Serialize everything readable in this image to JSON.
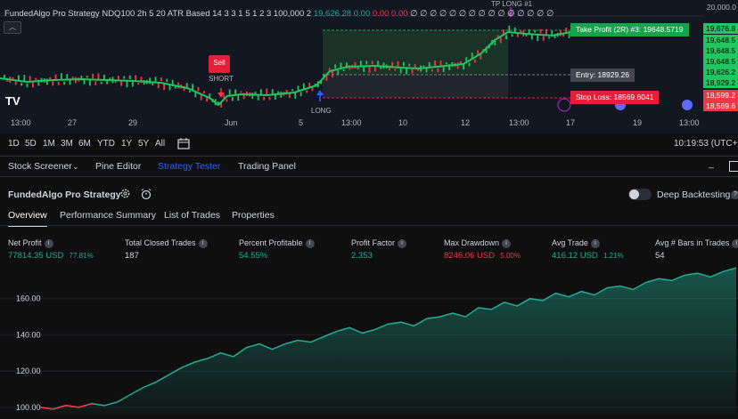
{
  "chart": {
    "legend": {
      "symbol_title": "FundedAlgo Pro Strategy",
      "params": "NDQ100 2h 5 20 ATR Based 14 3 3 1 5 1 2 3 100,000 2",
      "value_green": "19,626.28",
      "value_zero_green": "0.00",
      "value_zero_red": "0.00",
      "value_zero_red2": "0.00",
      "placeholder_symbols": "∅ ∅ ∅ ∅ ∅ ∅ ∅ ∅ ∅ ∅ ∅ ∅ ∅ ∅ ∅"
    },
    "collapse_icon": "chevron-up-icon",
    "top_price": "20,000.0",
    "price_labels": [
      {
        "text": "19,676.8",
        "color": "#22c55e"
      },
      {
        "text": "19,648.5",
        "color": "#22c55e"
      },
      {
        "text": "19,648.5",
        "color": "#22c55e"
      },
      {
        "text": "19,648.5",
        "color": "#22c55e"
      },
      {
        "text": "19,626.2",
        "color": "#22c55e"
      },
      {
        "text": "18,929.2",
        "color": "#22c55e"
      },
      {
        "text": "18,599.2",
        "color": "#f23645"
      },
      {
        "text": "18,569.6",
        "color": "#f23645"
      }
    ],
    "tp_label": "Take Profit (2R) #3: 19648.5719",
    "entry_label": "Entry: 18929.26",
    "sl_label": "Stop Loss: 18569.6041",
    "tp_long_label": "TP LONG #1",
    "sell_label": "Sell",
    "short_label": "SHORT",
    "long_label": "LONG",
    "logo_text": "TV",
    "x_labels": [
      "13:00",
      "27",
      "29",
      "Jun",
      "5",
      "13:00",
      "10",
      "12",
      "13:00",
      "17",
      "19",
      "13:00"
    ],
    "colors": {
      "up": "#22c55e",
      "down": "#f23645",
      "tp": "#16a34a",
      "entry": "#787b86",
      "sl": "#e51e3a"
    }
  },
  "range_bar": {
    "ranges": [
      "1D",
      "5D",
      "1M",
      "3M",
      "6M",
      "YTD",
      "1Y",
      "5Y",
      "All"
    ],
    "calendar_icon": "calendar-range-icon",
    "clock": "10:19:53 (UTC+"
  },
  "panel_tabs": {
    "items": [
      "Stock Screener",
      "Pine Editor",
      "Strategy Tester",
      "Trading Panel"
    ],
    "active": "Strategy Tester",
    "dropdown_icon": "chevron-down-icon",
    "minimize_icon": "minimize-icon",
    "maximize_icon": "maximize-icon"
  },
  "strategy": {
    "title": "FundedAlgo Pro Strategy",
    "settings_icon": "gear-icon",
    "alert_icon": "alarm-clock-icon",
    "deep_backtesting_label": "Deep Backtesting",
    "deep_backtesting_on": false,
    "subtabs": [
      "Overview",
      "Performance Summary",
      "List of Trades",
      "Properties"
    ],
    "active_subtab": "Overview"
  },
  "metrics": [
    {
      "label": "Net Profit",
      "value": "77814.35 USD",
      "extra": "77.81%",
      "color": "#22ab94"
    },
    {
      "label": "Total Closed Trades",
      "value": "187",
      "extra": "",
      "color": "#d1d4dc"
    },
    {
      "label": "Percent Profitable",
      "value": "54.55%",
      "extra": "",
      "color": "#22ab94"
    },
    {
      "label": "Profit Factor",
      "value": "2.353",
      "extra": "",
      "color": "#22ab94"
    },
    {
      "label": "Max Drawdown",
      "value": "8246.06 USD",
      "extra": "5.00%",
      "color": "#f23645"
    },
    {
      "label": "Avg Trade",
      "value": "416.12 USD",
      "extra": "1.21%",
      "color": "#22ab94"
    },
    {
      "label": "Avg # Bars in Trades",
      "value": "54",
      "extra": "",
      "color": "#d1d4dc"
    }
  ],
  "chart_data": {
    "type": "area",
    "title": "",
    "xlabel": "",
    "ylabel": "",
    "ylim": [
      96,
      180
    ],
    "y_ticks": [
      "100.00",
      "120.00",
      "140.00",
      "160.00"
    ],
    "y_tick_values": [
      100,
      120,
      140,
      160
    ],
    "series": [
      {
        "values": [
          100,
          99,
          101,
          100,
          102,
          101,
          103,
          107,
          111,
          114,
          118,
          122,
          125,
          127,
          130,
          128,
          133,
          135,
          132,
          135,
          137,
          136,
          139,
          142,
          144,
          141,
          143,
          146,
          147,
          145,
          149,
          150,
          152,
          150,
          155,
          154,
          158,
          156,
          160,
          159,
          163,
          161,
          164,
          162,
          166,
          167,
          165,
          169,
          171,
          170,
          173,
          174,
          172,
          175,
          177
        ]
      }
    ],
    "line_color": "#22ab94",
    "negative_color": "#f23645"
  }
}
